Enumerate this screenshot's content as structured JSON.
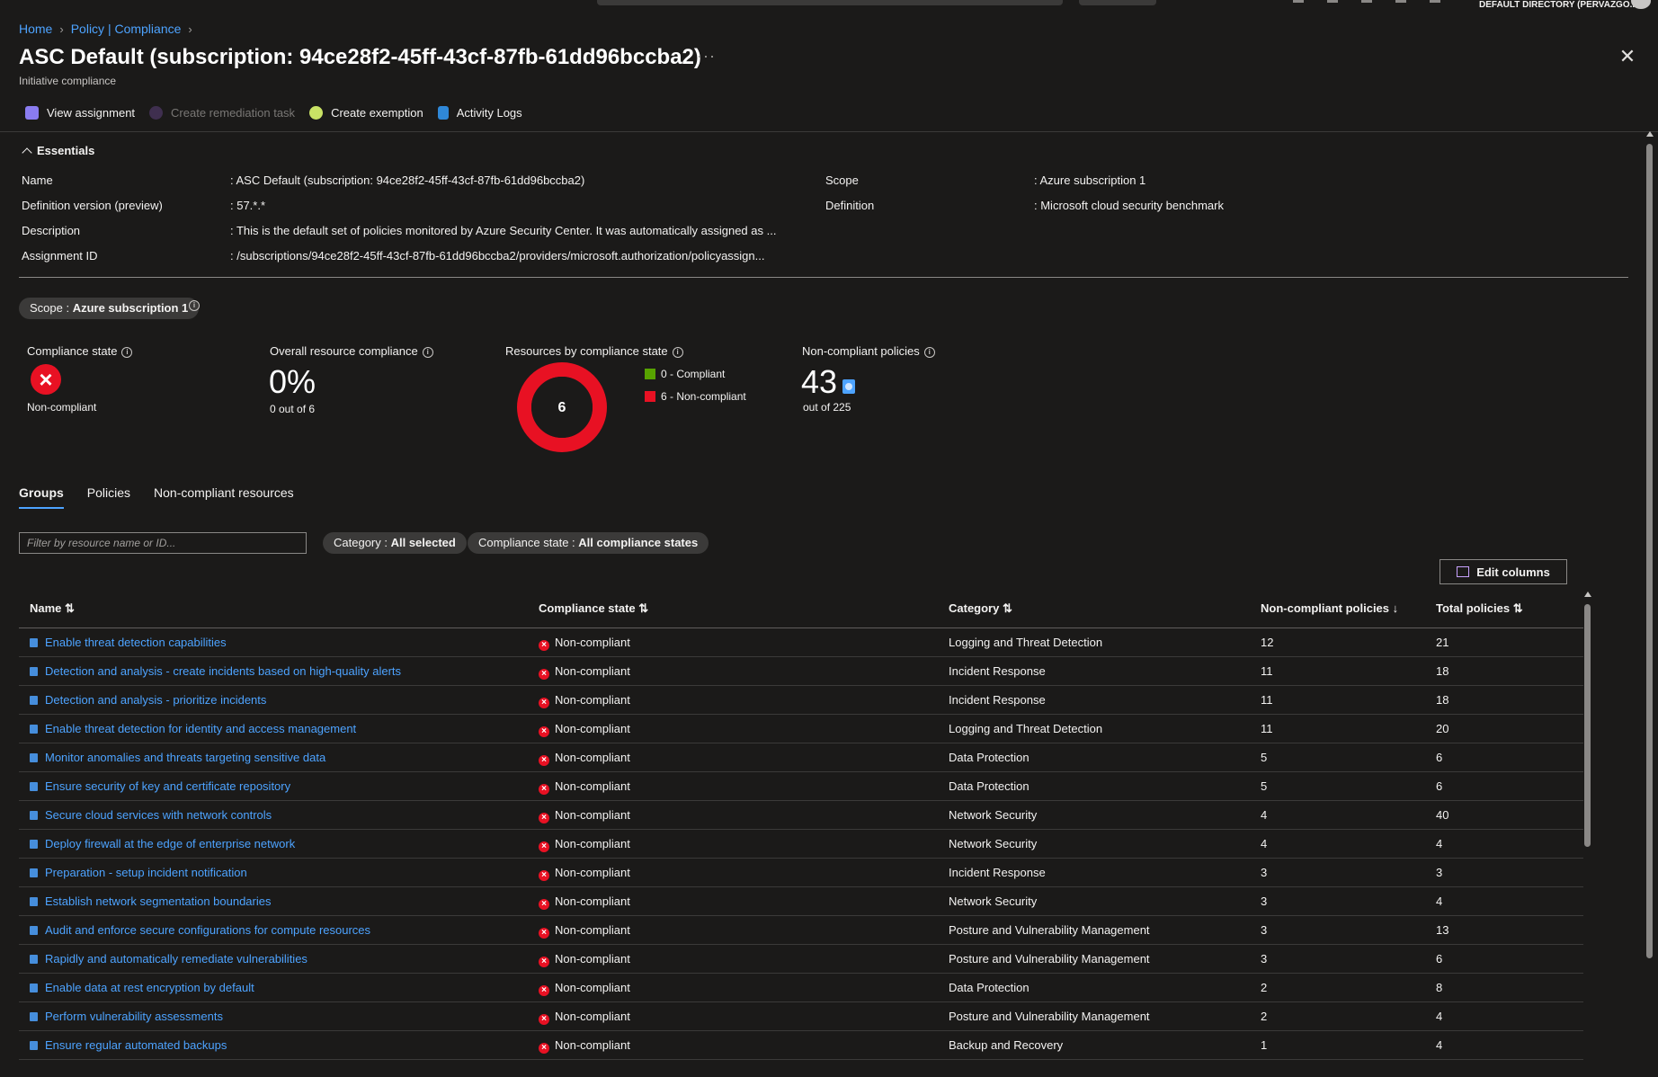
{
  "topbar": {
    "directory": "DEFAULT DIRECTORY (PERVAZGO..."
  },
  "breadcrumb": {
    "home": "Home",
    "policy": "Policy | Compliance"
  },
  "header": {
    "title": "ASC Default (subscription: 94ce28f2-45ff-43cf-87fb-61dd96bccba2)",
    "subtitle": "Initiative compliance",
    "more": "···",
    "close": "✕"
  },
  "toolbar": {
    "view_assignment": "View assignment",
    "create_remediation": "Create remediation task",
    "create_exemption": "Create exemption",
    "activity_logs": "Activity Logs"
  },
  "essentials": {
    "heading": "Essentials",
    "name_label": "Name",
    "name_value": ": ASC Default (subscription: 94ce28f2-45ff-43cf-87fb-61dd96bccba2)",
    "defver_label": "Definition version (preview)",
    "defver_value": ": 57.*.*",
    "desc_label": "Description",
    "desc_value": ": This is the default set of policies monitored by Azure Security Center. It was automatically assigned as ...",
    "assign_label": "Assignment ID",
    "assign_value": ": /subscriptions/94ce28f2-45ff-43cf-87fb-61dd96bccba2/providers/microsoft.authorization/policyassign...",
    "scope_label": "Scope",
    "scope_value": ": Azure subscription 1",
    "definition_label": "Definition",
    "definition_value": ": Microsoft cloud security benchmark"
  },
  "scope_pill": {
    "label": "Scope : ",
    "value": "Azure subscription 1"
  },
  "metrics": {
    "compliance_state_label": "Compliance state",
    "compliance_state_value": "Non-compliant",
    "overall_label": "Overall resource compliance",
    "overall_value": "0%",
    "overall_sub": "0 out of 6",
    "resources_label": "Resources by compliance state",
    "resources_total": "6",
    "compliant_count": 0,
    "noncompliant_count": 6,
    "legend_compliant": "0 - Compliant",
    "legend_noncompliant": "6 - Non-compliant",
    "noncompliant_policies_label": "Non-compliant policies",
    "noncompliant_policies_value": "43",
    "noncompliant_policies_sub": "out of 225",
    "colors": {
      "compliant": "#57a300",
      "noncompliant": "#e81123"
    }
  },
  "tabs": [
    "Groups",
    "Policies",
    "Non-compliant resources"
  ],
  "filters": {
    "search_placeholder": "Filter by resource name or ID...",
    "category_label": "Category : ",
    "category_value": "All selected",
    "state_label": "Compliance state : ",
    "state_value": "All compliance states",
    "edit_columns": "Edit columns"
  },
  "table": {
    "headers": {
      "name": "Name ⇅",
      "state": "Compliance state ⇅",
      "category": "Category ⇅",
      "noncompliant": "Non-compliant policies ↓",
      "total": "Total policies ⇅"
    },
    "rows": [
      {
        "name": "Enable threat detection capabilities",
        "state": "Non-compliant",
        "category": "Logging and Threat Detection",
        "nc": "12",
        "total": "21"
      },
      {
        "name": "Detection and analysis - create incidents based on high-quality alerts",
        "state": "Non-compliant",
        "category": "Incident Response",
        "nc": "11",
        "total": "18"
      },
      {
        "name": "Detection and analysis - prioritize incidents",
        "state": "Non-compliant",
        "category": "Incident Response",
        "nc": "11",
        "total": "18"
      },
      {
        "name": "Enable threat detection for identity and access management",
        "state": "Non-compliant",
        "category": "Logging and Threat Detection",
        "nc": "11",
        "total": "20"
      },
      {
        "name": "Monitor anomalies and threats targeting sensitive data",
        "state": "Non-compliant",
        "category": "Data Protection",
        "nc": "5",
        "total": "6"
      },
      {
        "name": "Ensure security of key and certificate repository",
        "state": "Non-compliant",
        "category": "Data Protection",
        "nc": "5",
        "total": "6"
      },
      {
        "name": "Secure cloud services with network controls",
        "state": "Non-compliant",
        "category": "Network Security",
        "nc": "4",
        "total": "40"
      },
      {
        "name": "Deploy firewall at the edge of enterprise network",
        "state": "Non-compliant",
        "category": "Network Security",
        "nc": "4",
        "total": "4"
      },
      {
        "name": "Preparation - setup incident notification",
        "state": "Non-compliant",
        "category": "Incident Response",
        "nc": "3",
        "total": "3"
      },
      {
        "name": "Establish network segmentation boundaries",
        "state": "Non-compliant",
        "category": "Network Security",
        "nc": "3",
        "total": "4"
      },
      {
        "name": "Audit and enforce secure configurations for compute resources",
        "state": "Non-compliant",
        "category": "Posture and Vulnerability Management",
        "nc": "3",
        "total": "13"
      },
      {
        "name": "Rapidly and automatically remediate vulnerabilities",
        "state": "Non-compliant",
        "category": "Posture and Vulnerability Management",
        "nc": "3",
        "total": "6"
      },
      {
        "name": "Enable data at rest encryption by default",
        "state": "Non-compliant",
        "category": "Data Protection",
        "nc": "2",
        "total": "8"
      },
      {
        "name": "Perform vulnerability assessments",
        "state": "Non-compliant",
        "category": "Posture and Vulnerability Management",
        "nc": "2",
        "total": "4"
      },
      {
        "name": "Ensure regular automated backups",
        "state": "Non-compliant",
        "category": "Backup and Recovery",
        "nc": "1",
        "total": "4"
      }
    ]
  }
}
